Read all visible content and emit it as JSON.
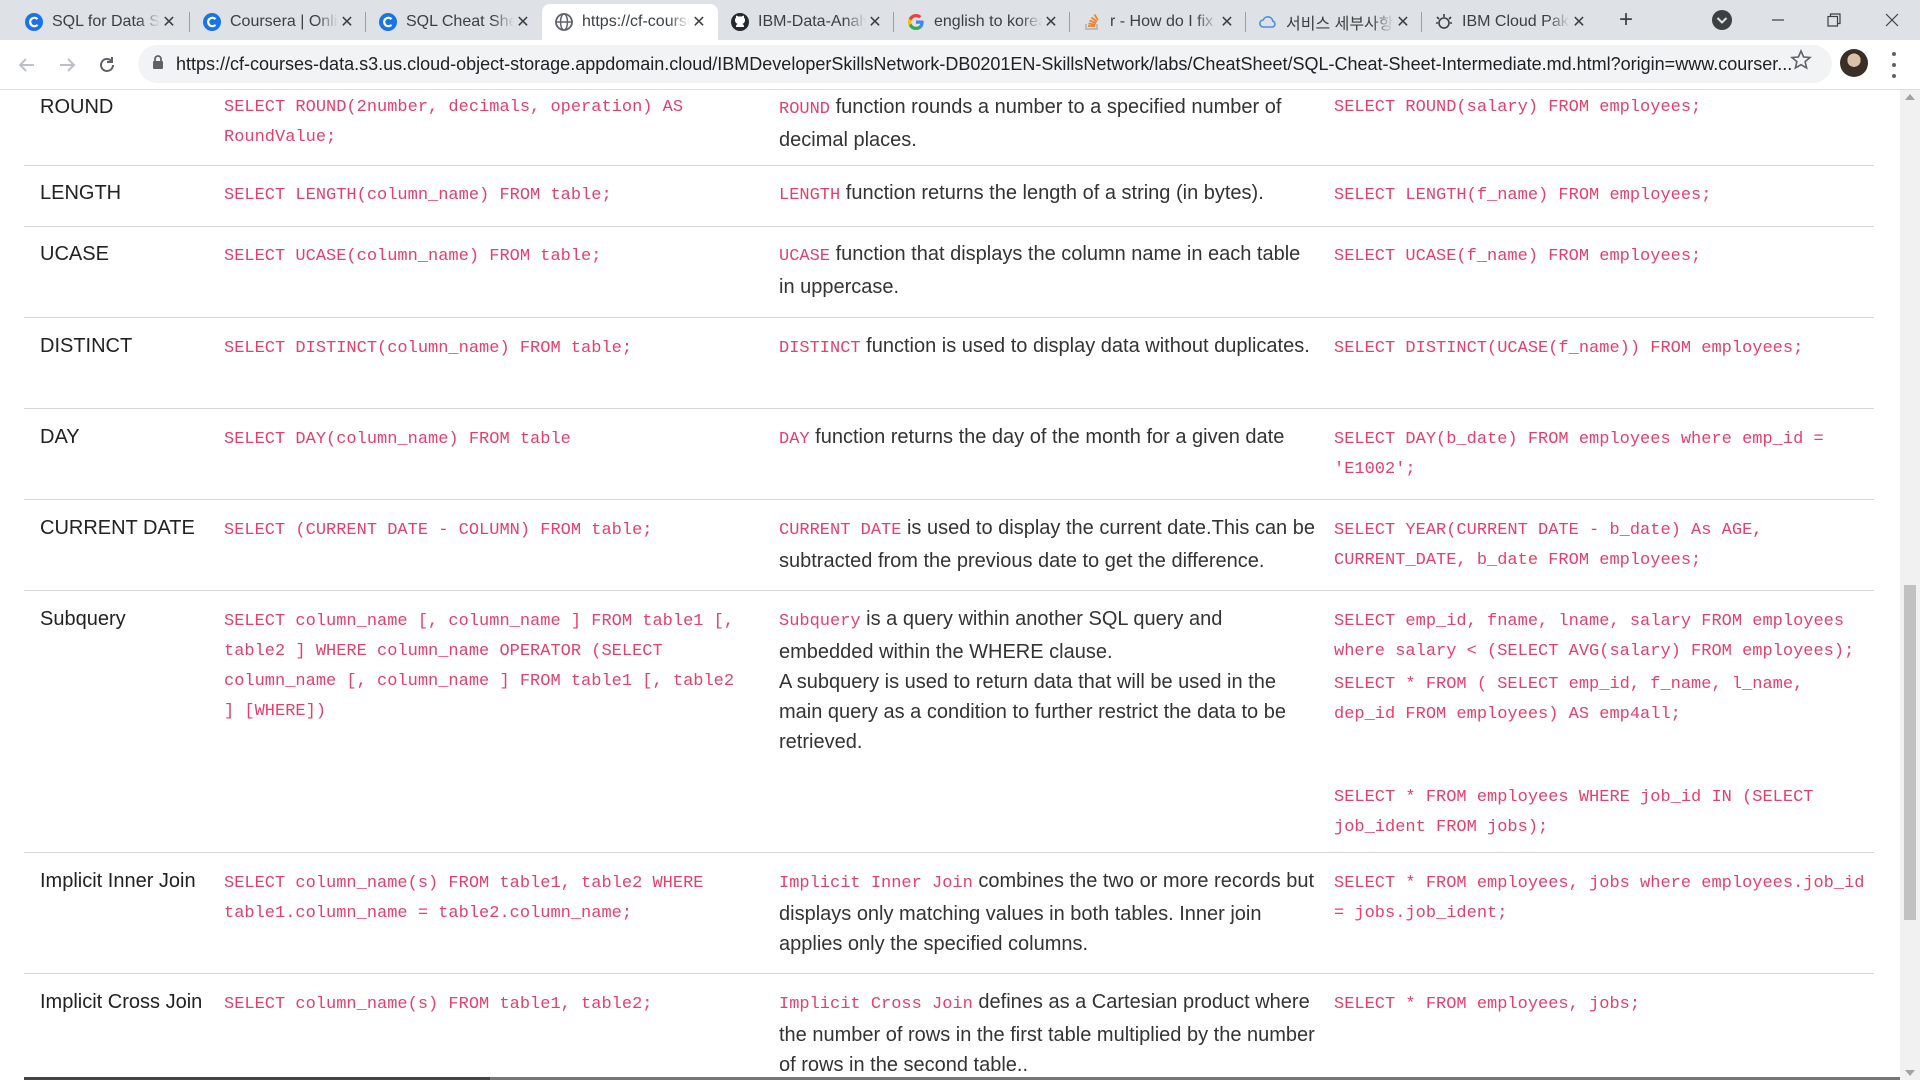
{
  "browser": {
    "tabs": [
      {
        "icon": "coursera-icon",
        "title": "SQL for Data Science",
        "active": false
      },
      {
        "icon": "coursera-icon",
        "title": "Coursera | Online Courses",
        "active": false
      },
      {
        "icon": "coursera-icon",
        "title": "SQL Cheat Sheet",
        "active": false
      },
      {
        "icon": "globe-icon",
        "title": "https://cf-courses-data",
        "active": true
      },
      {
        "icon": "github-icon",
        "title": "IBM-Data-Analyst",
        "active": false
      },
      {
        "icon": "google-icon",
        "title": "english to korean",
        "active": false
      },
      {
        "icon": "stackoverflow-icon",
        "title": "r - How do I fix",
        "active": false
      },
      {
        "icon": "cloud-icon",
        "title": "서비스 세부사항",
        "active": false
      },
      {
        "icon": "ibm-cloud-icon",
        "title": "IBM Cloud Pak",
        "active": false
      }
    ],
    "url": "https://cf-courses-data.s3.us.cloud-object-storage.appdomain.cloud/IBMDeveloperSkillsNetwork-DB0201EN-SkillsNetwork/labs/CheatSheet/SQL-Cheat-Sheet-Intermediate.md.html?origin=www.courser...",
    "accent": "#1a73e8"
  },
  "table": {
    "rows": [
      {
        "command": "ROUND",
        "syntax": "SELECT ROUND(2number, decimals, operation) AS RoundValue;",
        "desc_code": "ROUND",
        "desc_text": " function rounds a number to a specified number of decimal places.",
        "example": "SELECT ROUND(salary) FROM employees;"
      },
      {
        "command": "LENGTH",
        "syntax": "SELECT LENGTH(column_name) FROM table;",
        "desc_code": "LENGTH",
        "desc_text": " function returns the length of a string (in bytes).",
        "example": "SELECT LENGTH(f_name) FROM employees;"
      },
      {
        "command": "UCASE",
        "syntax": "SELECT UCASE(column_name) FROM table;",
        "desc_code": "UCASE",
        "desc_text": " function that displays the column name in each table in uppercase.",
        "example": "SELECT UCASE(f_name) FROM employees;"
      },
      {
        "command": "DISTINCT",
        "syntax": "SELECT DISTINCT(column_name) FROM table;",
        "desc_code": "DISTINCT",
        "desc_text": " function is used to display data without duplicates.",
        "example": "SELECT DISTINCT(UCASE(f_name)) FROM employees;"
      },
      {
        "command": "DAY",
        "syntax": "SELECT DAY(column_name) FROM table",
        "desc_code": "DAY",
        "desc_text": " function returns the day of the month for a given date",
        "example": "SELECT DAY(b_date) FROM employees where emp_id = 'E1002';"
      },
      {
        "command": "CURRENT DATE",
        "syntax": "SELECT (CURRENT DATE - COLUMN) FROM table;",
        "desc_code": "CURRENT DATE",
        "desc_text": " is used to display the current date.This can be subtracted from the previous date to get the difference.",
        "example": "SELECT YEAR(CURRENT DATE - b_date) As AGE, CURRENT_DATE, b_date FROM employees;"
      },
      {
        "command": "Subquery",
        "syntax": "SELECT column_name [, column_name ] FROM table1 [, table2 ] WHERE column_name OPERATOR (SELECT column_name [, column_name ] FROM table1 [, table2 ] [WHERE])",
        "desc_code": "Subquery",
        "desc_text": " is a query within another SQL query and embedded within the WHERE clause.",
        "desc_text2": "A subquery is used to return data that will be used in the main query as a condition to further restrict the data to be retrieved.",
        "example": "SELECT emp_id, fname, lname, salary FROM employees where salary < (SELECT AVG(salary) FROM employees);",
        "example2": "SELECT * FROM ( SELECT emp_id, f_name, l_name, dep_id FROM employees) AS emp4all;",
        "example3": "SELECT * FROM employees WHERE job_id IN (SELECT job_ident FROM jobs);"
      },
      {
        "command": "Implicit Inner Join",
        "syntax": "SELECT column_name(s) FROM table1, table2 WHERE table1.column_name = table2.column_name;",
        "desc_code": "Implicit Inner Join",
        "desc_text": " combines the two or more records but displays only matching values in both tables. Inner join applies only the specified columns.",
        "example": "SELECT * FROM employees, jobs where employees.job_id = jobs.job_ident;"
      },
      {
        "command": "Implicit Cross Join",
        "syntax": "SELECT column_name(s) FROM table1, table2;",
        "desc_code": "Implicit Cross Join",
        "desc_text": " defines as a Cartesian product where the number of rows in the first table multiplied by the number of rows in the second table..",
        "example": "SELECT * FROM employees, jobs;"
      }
    ]
  },
  "colors": {
    "code": "#e83e6c",
    "tabstrip": "#dee1e6"
  }
}
